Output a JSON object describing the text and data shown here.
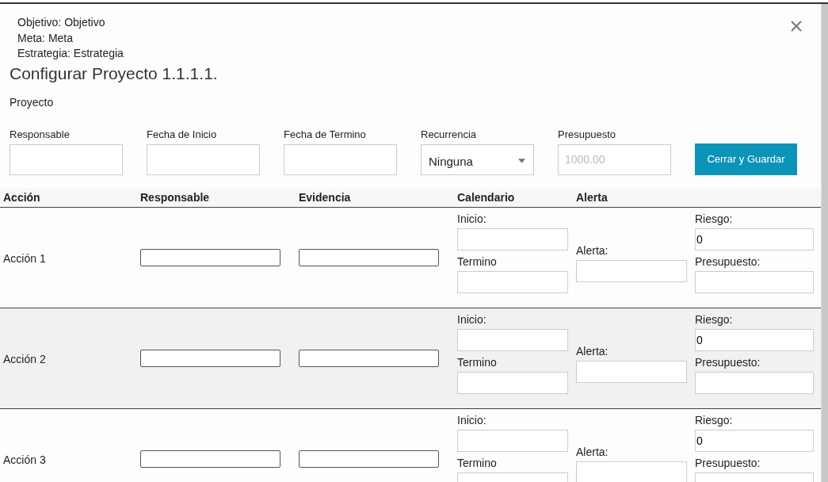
{
  "context": [
    "Objetivo: Objetivo",
    "Meta: Meta",
    "Estrategia: Estrategia"
  ],
  "title": "Configurar Proyecto 1.1.1.1.",
  "section": "Proyecto",
  "form": {
    "fields": [
      {
        "kind": "text",
        "label": "Responsable"
      },
      {
        "kind": "text",
        "label": "Fecha de Inicio"
      },
      {
        "kind": "text",
        "label": "Fecha de Termino"
      },
      {
        "kind": "select",
        "label": "Recurrencia",
        "value": "Ninguna"
      },
      {
        "kind": "text",
        "label": "Presupuesto",
        "placeholder": "1000.00"
      }
    ],
    "button": "Cerrar y Guardar"
  },
  "table": {
    "columns": [
      "Acción",
      "Responsable",
      "Evidencia",
      "Calendario",
      "Alerta"
    ],
    "rows": [
      {
        "action": "Acción 1",
        "start_label": "Inicio:",
        "end_label": "Termino",
        "alert_label": "Alerta:",
        "risk_label": "Riesgo:",
        "risk_value": "0",
        "budget_label": "Presupuesto:"
      },
      {
        "action": "Acción 2",
        "start_label": "Inicio:",
        "end_label": "Termino",
        "alert_label": "Alerta:",
        "risk_label": "Riesgo:",
        "risk_value": "0",
        "budget_label": "Presupuesto:"
      },
      {
        "action": "Acción 3",
        "start_label": "Inicio:",
        "end_label": "Termino",
        "alert_label": "Alerta:",
        "risk_label": "Riesgo:",
        "risk_value": "0",
        "budget_label": "Presupuesto:"
      }
    ]
  }
}
